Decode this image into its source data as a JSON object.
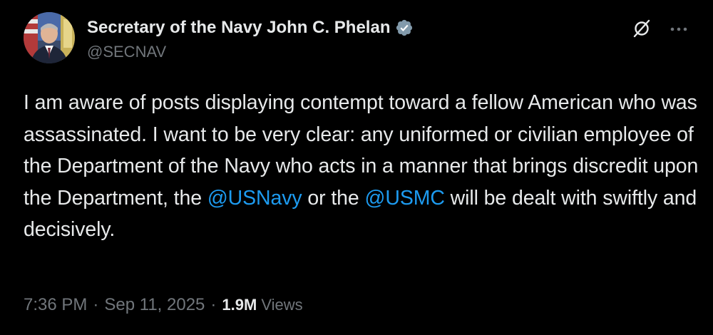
{
  "author": {
    "display_name": "Secretary of the Navy John C. Phelan",
    "handle": "@SECNAV",
    "verified_icon": "verified-badge-icon",
    "avatar_icon": "avatar"
  },
  "actions": {
    "grok_icon": "grok-icon",
    "more_icon": "more-icon"
  },
  "tweet": {
    "text_part1": "I am aware of posts displaying contempt toward a fellow American who was assassinated. I want to be very clear: any uniformed or civilian employee of the Department of the Navy who acts in a manner that brings discredit upon the Department, the ",
    "mention1": "@USNavy",
    "text_part2": " or the ",
    "mention2": "@USMC",
    "text_part3": " will be dealt with swiftly and decisively."
  },
  "meta": {
    "time": "7:36 PM",
    "separator": "·",
    "date": "Sep 11, 2025",
    "views_count": "1.9M",
    "views_label": "Views"
  },
  "colors": {
    "background": "#000000",
    "text": "#e7e9ea",
    "secondary": "#71767b",
    "link": "#1d9bf0",
    "verified": "#829aab"
  }
}
